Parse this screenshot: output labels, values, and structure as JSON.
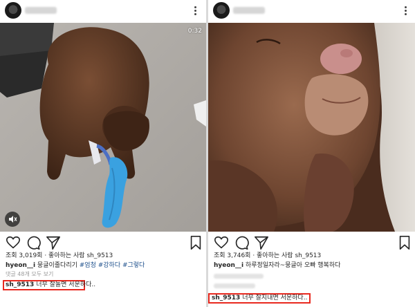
{
  "left_post": {
    "video_duration": "0:32",
    "views_text": "조회 3,019회 · 좋아하는 사람 sh_9513",
    "caption_user": "hyeon__i",
    "caption_text": " 뭉글이줄다리기 ",
    "caption_tags": "#엄청 #강하다 #그렇다",
    "comments_text": "댓글 48개 모두 보기",
    "highlight_user": "sh_9513",
    "highlight_text": " 너무 잘놀면 서운하다.."
  },
  "right_post": {
    "views_text": "조회 3,746회 · 좋아하는 사람 sh_9513",
    "caption_user": "hyeon__i",
    "caption_text": " 하루정일자라~뭉글아 오빠 행복하다",
    "highlight_user": "sh_9513",
    "highlight_text": " 너무 잘지내면 서운하다.."
  },
  "colors": {
    "highlight_border": "#e8281e",
    "hashtag": "#1a4d8a",
    "puppy_brown": "#5e3a26",
    "toy_blue": "#3aa1e0"
  },
  "icons": [
    "more-icon",
    "sound-icon",
    "heart-icon",
    "comment-icon",
    "share-icon",
    "bookmark-icon"
  ]
}
